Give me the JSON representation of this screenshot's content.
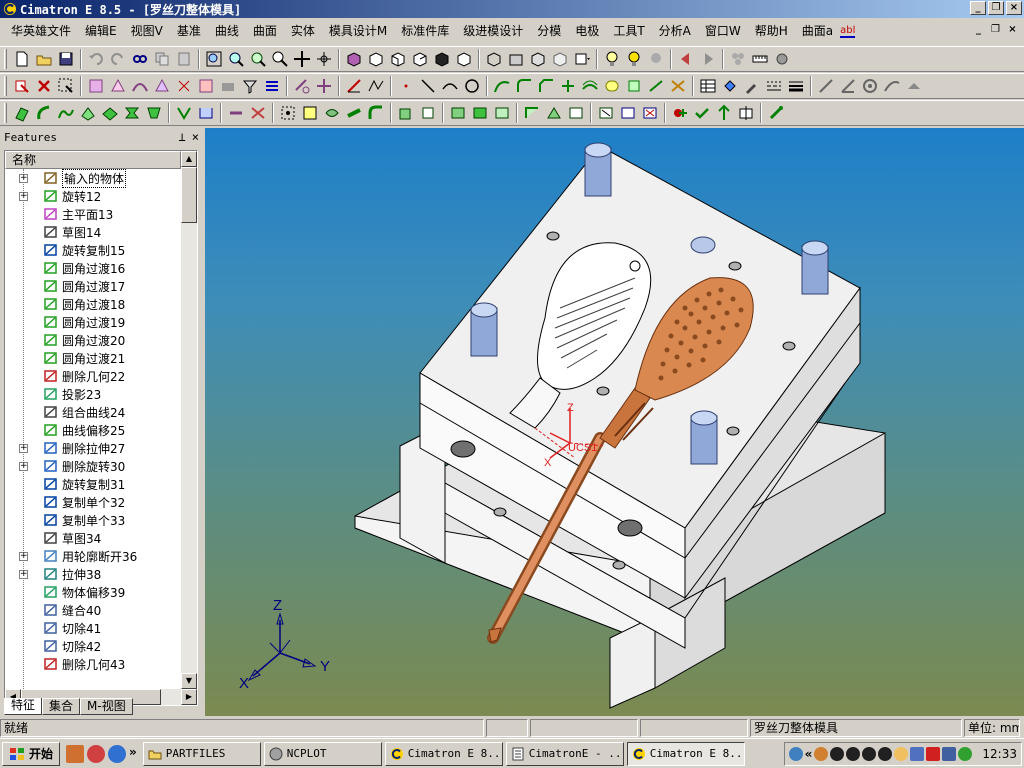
{
  "window": {
    "title": "Cimatron E 8.5 - [罗丝刀整体模具]",
    "app_icon": "cimatron-c-icon"
  },
  "menu": {
    "items": [
      {
        "label": "华英雄文件"
      },
      {
        "label": "编辑E"
      },
      {
        "label": "视图V"
      },
      {
        "label": "基准"
      },
      {
        "label": "曲线"
      },
      {
        "label": "曲面"
      },
      {
        "label": "实体"
      },
      {
        "label": "模具设计M"
      },
      {
        "label": "标准件库"
      },
      {
        "label": "级进模设计"
      },
      {
        "label": "分模"
      },
      {
        "label": "电极"
      },
      {
        "label": "工具T"
      },
      {
        "label": "分析A"
      },
      {
        "label": "窗口W"
      },
      {
        "label": "帮助H"
      },
      {
        "label": "曲面a"
      }
    ]
  },
  "features_panel": {
    "title": "Features",
    "column_header": "名称",
    "items": [
      {
        "label": "输入的物体",
        "icon": "imported-object-icon",
        "expandable": true
      },
      {
        "label": "旋转12",
        "icon": "revolve-icon",
        "expandable": true
      },
      {
        "label": "主平面13",
        "icon": "main-plane-icon",
        "expandable": false
      },
      {
        "label": "草图14",
        "icon": "sketch-icon",
        "expandable": false
      },
      {
        "label": "旋转复制15",
        "icon": "rotate-copy-icon",
        "expandable": false
      },
      {
        "label": "圆角过渡16",
        "icon": "fillet-icon",
        "expandable": false
      },
      {
        "label": "圆角过渡17",
        "icon": "fillet-icon",
        "expandable": false
      },
      {
        "label": "圆角过渡18",
        "icon": "fillet-icon",
        "expandable": false
      },
      {
        "label": "圆角过渡19",
        "icon": "fillet-icon",
        "expandable": false
      },
      {
        "label": "圆角过渡20",
        "icon": "fillet-icon",
        "expandable": false
      },
      {
        "label": "圆角过渡21",
        "icon": "fillet-icon",
        "expandable": false
      },
      {
        "label": "删除几何22",
        "icon": "delete-geometry-icon",
        "expandable": false
      },
      {
        "label": "投影23",
        "icon": "project-icon",
        "expandable": false
      },
      {
        "label": "组合曲线24",
        "icon": "composite-curve-icon",
        "expandable": false
      },
      {
        "label": "曲线偏移25",
        "icon": "curve-offset-icon",
        "expandable": false
      },
      {
        "label": "删除拉伸27",
        "icon": "delete-extrude-icon",
        "expandable": true
      },
      {
        "label": "删除旋转30",
        "icon": "delete-revolve-icon",
        "expandable": true
      },
      {
        "label": "旋转复制31",
        "icon": "rotate-copy-icon",
        "expandable": false
      },
      {
        "label": "复制单个32",
        "icon": "copy-single-icon",
        "expandable": false
      },
      {
        "label": "复制单个33",
        "icon": "copy-single-icon",
        "expandable": false
      },
      {
        "label": "草图34",
        "icon": "sketch-icon",
        "expandable": false
      },
      {
        "label": "用轮廓断开36",
        "icon": "split-by-contour-icon",
        "expandable": true
      },
      {
        "label": "拉伸38",
        "icon": "extrude-icon",
        "expandable": true
      },
      {
        "label": "物体偏移39",
        "icon": "object-offset-icon",
        "expandable": false
      },
      {
        "label": "缝合40",
        "icon": "stitch-icon",
        "expandable": false
      },
      {
        "label": "切除41",
        "icon": "cut-icon",
        "expandable": false
      },
      {
        "label": "切除42",
        "icon": "cut-icon",
        "expandable": false
      },
      {
        "label": "删除几何43",
        "icon": "delete-geometry-icon",
        "expandable": false
      }
    ],
    "tabs": [
      {
        "label": "特征"
      },
      {
        "label": "集合"
      },
      {
        "label": "M-视图"
      }
    ]
  },
  "viewport": {
    "axis_labels": {
      "x": "X",
      "y": "Y",
      "z": "Z"
    },
    "ucs_label": "UCS1",
    "ucs_axis_labels": {
      "x": "X",
      "z": "Z"
    }
  },
  "status": {
    "message": "就绪",
    "document": "罗丝刀整体模具",
    "unit": "单位: mm"
  },
  "taskbar": {
    "start_label": "开始",
    "tasks": [
      {
        "label": "PARTFILES",
        "icon": "folder-icon"
      },
      {
        "label": "NCPLOT",
        "icon": "ncplot-icon"
      },
      {
        "label": "Cimatron E 8...",
        "icon": "cimatron-c-icon"
      },
      {
        "label": "CimatronE - ...",
        "icon": "document-icon"
      },
      {
        "label": "Cimatron E 8...",
        "icon": "cimatron-c-icon",
        "active": true
      }
    ],
    "clock": "12:33"
  },
  "colors": {
    "titlebar_start": "#0a246a",
    "titlebar_end": "#a6caf0",
    "viewport_top": "#1e7fc8",
    "viewport_bottom": "#7b8a50",
    "mold": "#f2f2f2",
    "handle_copper": "#c8743c",
    "guide_pin": "#8fa8d8",
    "axis_red": "#e02020"
  }
}
